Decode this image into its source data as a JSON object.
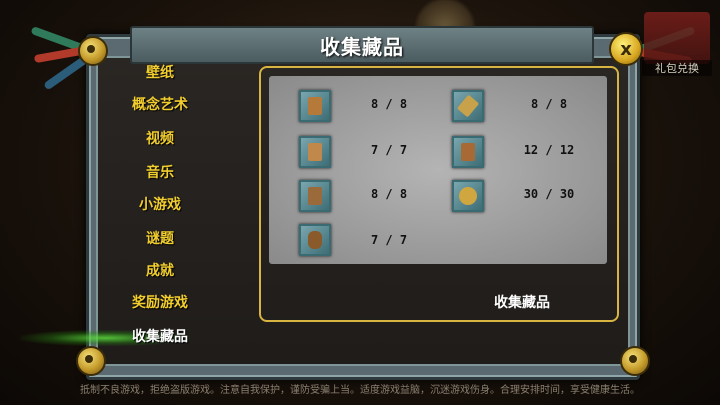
{
  "title": "收集藏品",
  "close_button": "x",
  "gift_label": "礼包兑换",
  "sidebar": {
    "items": [
      {
        "label": "壁纸"
      },
      {
        "label": "概念艺术"
      },
      {
        "label": "视频"
      },
      {
        "label": "音乐"
      },
      {
        "label": "小游戏"
      },
      {
        "label": "谜题"
      },
      {
        "label": "成就"
      },
      {
        "label": "奖励游戏"
      },
      {
        "label": "收集藏品",
        "active": true
      }
    ]
  },
  "collectibles": [
    {
      "icon": "mask-icon",
      "count": "8 / 8"
    },
    {
      "icon": "scroll-icon",
      "count": "8 / 8"
    },
    {
      "icon": "temple-icon",
      "count": "7 / 7"
    },
    {
      "icon": "stone-tablet-icon",
      "count": "12 / 12"
    },
    {
      "icon": "idol-icon",
      "count": "8 / 8"
    },
    {
      "icon": "sun-disc-icon",
      "count": "30 / 30"
    },
    {
      "icon": "urn-icon",
      "count": "7 / 7"
    }
  ],
  "content_footer": "收集藏品",
  "notice": "抵制不良游戏，拒绝盗版游戏。注意自我保护，谨防受骗上当。适度游戏益脑，沉迷游戏伤身。合理安排时间，享受健康生活。",
  "colors": {
    "accent_gold": "#f2ce2e",
    "panel_border": "#d8b440",
    "active_glow": "#5adc3c"
  }
}
